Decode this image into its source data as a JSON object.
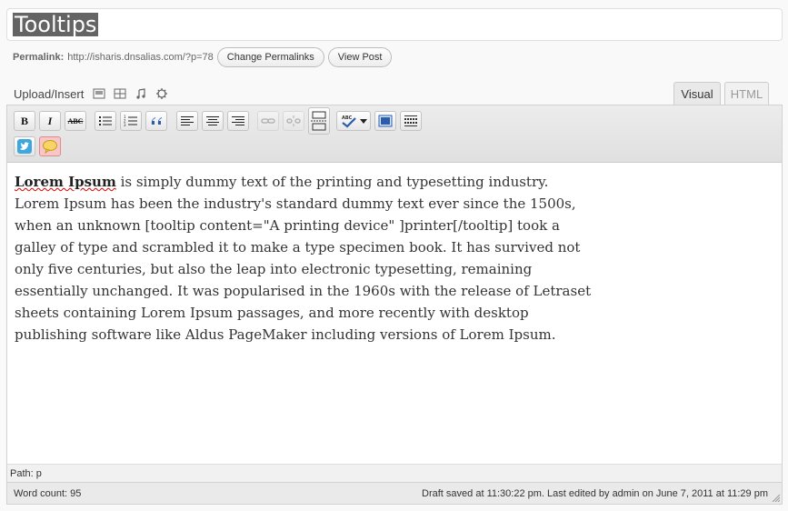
{
  "post": {
    "title": "Tooltips"
  },
  "permalink": {
    "label": "Permalink:",
    "url": "http://isharis.dnsalias.com/?p=78",
    "change_label": "Change Permalinks",
    "view_label": "View Post"
  },
  "media": {
    "label": "Upload/Insert",
    "icons": [
      "add-image-icon",
      "add-video-icon",
      "add-audio-icon",
      "add-media-icon"
    ]
  },
  "tabs": {
    "visual": "Visual",
    "html": "HTML"
  },
  "toolbar": {
    "row1": [
      "bold-icon",
      "italic-icon",
      "strikethrough-icon",
      "bullet-list-icon",
      "numbered-list-icon",
      "blockquote-icon",
      "align-left-icon",
      "align-center-icon",
      "align-right-icon",
      "link-icon",
      "unlink-icon",
      "more-tag-icon",
      "spellcheck-icon",
      "fullscreen-icon",
      "kitchen-sink-icon"
    ],
    "row2": [
      "twitter-icon",
      "tooltip-icon"
    ],
    "bold_glyph": "B",
    "italic_glyph": "I",
    "strike_glyph": "ABC"
  },
  "content": {
    "bold_lead": "Lorem Ipsum",
    "body": " is simply dummy text of the printing and typesetting industry. Lorem Ipsum has been the industry's standard dummy text ever since the 1500s, when an unknown [tooltip content=\"A printing device\" ]printer[/tooltip] took a galley of type and scrambled it to make a type specimen book. It has survived not only five centuries, but also the leap into electronic typesetting, remaining essentially unchanged. It was popularised in the 1960s with the release of Letraset sheets containing Lorem Ipsum passages, and more recently with desktop publishing software like Aldus PageMaker including versions of Lorem Ipsum."
  },
  "path": {
    "text": "Path: p"
  },
  "status": {
    "word_count": "Word count: 95",
    "autosave": "Draft saved at 11:30:22 pm. Last edited by admin on June 7, 2011 at 11:29 pm"
  },
  "colors": {
    "tooltip_button_bg": "#f7c6c6",
    "spellcheck_blue": "#2a5db0",
    "twitter_blue": "#3fa7e0"
  }
}
